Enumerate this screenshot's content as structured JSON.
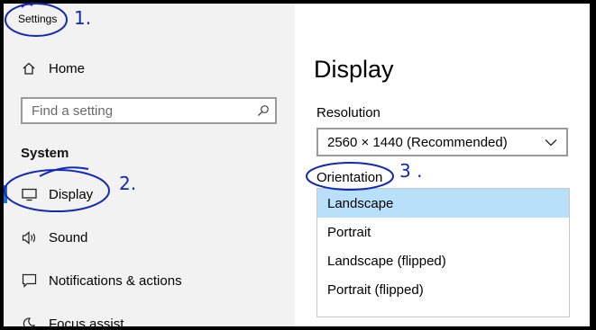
{
  "window": {
    "title": "Settings",
    "minimize_glyph": "–"
  },
  "sidebar": {
    "search_placeholder": "Find a setting",
    "section": "System",
    "items": [
      {
        "label": "Home",
        "icon": "home-icon"
      },
      {
        "label": "Display",
        "icon": "monitor-icon",
        "selected": true
      },
      {
        "label": "Sound",
        "icon": "speaker-icon"
      },
      {
        "label": "Notifications & actions",
        "icon": "notification-icon"
      },
      {
        "label": "Focus assist",
        "icon": "moon-icon"
      }
    ]
  },
  "main": {
    "heading": "Display",
    "resolution_label": "Resolution",
    "resolution_value": "2560 × 1440 (Recommended)",
    "orientation_label": "Orientation",
    "orientation_options": [
      "Landscape",
      "Portrait",
      "Landscape (flipped)",
      "Portrait (flipped)"
    ],
    "orientation_selected": "Landscape"
  },
  "annotations": [
    "1.",
    "2.",
    "3 ."
  ],
  "colors": {
    "accent": "#1a73c8",
    "selection": "#b8e0fb",
    "annotation_ink": "#1228b8"
  }
}
